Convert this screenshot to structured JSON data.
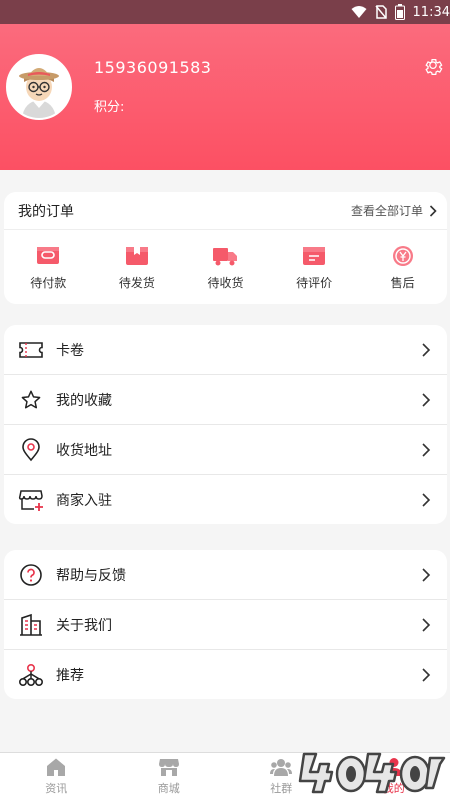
{
  "status_bar": {
    "time": "11:34"
  },
  "profile": {
    "phone": "15936091583",
    "points_label": "积分:"
  },
  "orders": {
    "title": "我的订单",
    "view_all": "查看全部订单",
    "items": [
      {
        "label": "待付款",
        "icon": "wallet-icon"
      },
      {
        "label": "待发货",
        "icon": "package-icon"
      },
      {
        "label": "待收货",
        "icon": "truck-icon"
      },
      {
        "label": "待评价",
        "icon": "review-icon"
      },
      {
        "label": "售后",
        "icon": "yen-coin-icon"
      }
    ]
  },
  "menu1": [
    {
      "label": "卡卷",
      "icon": "ticket-icon"
    },
    {
      "label": "我的收藏",
      "icon": "star-icon"
    },
    {
      "label": "收货地址",
      "icon": "location-pin-icon"
    },
    {
      "label": "商家入驻",
      "icon": "store-icon"
    }
  ],
  "menu2": [
    {
      "label": "帮助与反馈",
      "icon": "help-icon"
    },
    {
      "label": "关于我们",
      "icon": "building-icon"
    },
    {
      "label": "推荐",
      "icon": "share-network-icon"
    }
  ],
  "tabs": [
    {
      "label": "资讯",
      "icon": "home-icon",
      "active": false
    },
    {
      "label": "商城",
      "icon": "shop-icon",
      "active": false
    },
    {
      "label": "社群",
      "icon": "group-icon",
      "active": false
    },
    {
      "label": "我的",
      "icon": "person-icon",
      "active": true
    }
  ],
  "colors": {
    "accent": "#fc5063",
    "header_top": "#fb6b7d",
    "tab_active": "#e8344b"
  }
}
